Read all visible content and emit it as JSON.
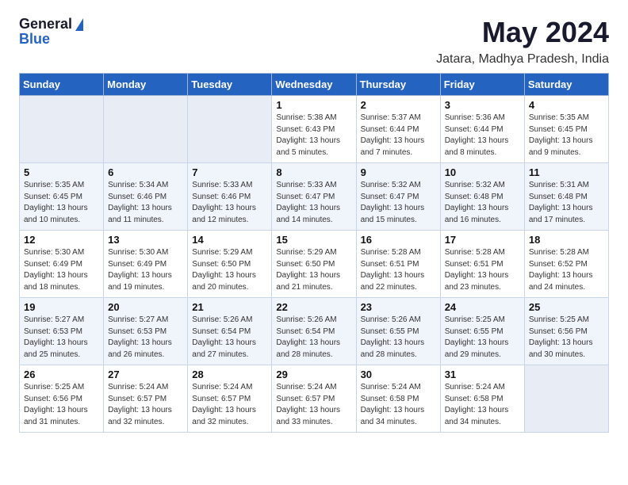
{
  "logo": {
    "general": "General",
    "blue": "Blue"
  },
  "title": "May 2024",
  "location": "Jatara, Madhya Pradesh, India",
  "days_of_week": [
    "Sunday",
    "Monday",
    "Tuesday",
    "Wednesday",
    "Thursday",
    "Friday",
    "Saturday"
  ],
  "weeks": [
    {
      "cells": [
        {
          "day": "",
          "info": ""
        },
        {
          "day": "",
          "info": ""
        },
        {
          "day": "",
          "info": ""
        },
        {
          "day": "1",
          "info": "Sunrise: 5:38 AM\nSunset: 6:43 PM\nDaylight: 13 hours\nand 5 minutes."
        },
        {
          "day": "2",
          "info": "Sunrise: 5:37 AM\nSunset: 6:44 PM\nDaylight: 13 hours\nand 7 minutes."
        },
        {
          "day": "3",
          "info": "Sunrise: 5:36 AM\nSunset: 6:44 PM\nDaylight: 13 hours\nand 8 minutes."
        },
        {
          "day": "4",
          "info": "Sunrise: 5:35 AM\nSunset: 6:45 PM\nDaylight: 13 hours\nand 9 minutes."
        }
      ]
    },
    {
      "cells": [
        {
          "day": "5",
          "info": "Sunrise: 5:35 AM\nSunset: 6:45 PM\nDaylight: 13 hours\nand 10 minutes."
        },
        {
          "day": "6",
          "info": "Sunrise: 5:34 AM\nSunset: 6:46 PM\nDaylight: 13 hours\nand 11 minutes."
        },
        {
          "day": "7",
          "info": "Sunrise: 5:33 AM\nSunset: 6:46 PM\nDaylight: 13 hours\nand 12 minutes."
        },
        {
          "day": "8",
          "info": "Sunrise: 5:33 AM\nSunset: 6:47 PM\nDaylight: 13 hours\nand 14 minutes."
        },
        {
          "day": "9",
          "info": "Sunrise: 5:32 AM\nSunset: 6:47 PM\nDaylight: 13 hours\nand 15 minutes."
        },
        {
          "day": "10",
          "info": "Sunrise: 5:32 AM\nSunset: 6:48 PM\nDaylight: 13 hours\nand 16 minutes."
        },
        {
          "day": "11",
          "info": "Sunrise: 5:31 AM\nSunset: 6:48 PM\nDaylight: 13 hours\nand 17 minutes."
        }
      ]
    },
    {
      "cells": [
        {
          "day": "12",
          "info": "Sunrise: 5:30 AM\nSunset: 6:49 PM\nDaylight: 13 hours\nand 18 minutes."
        },
        {
          "day": "13",
          "info": "Sunrise: 5:30 AM\nSunset: 6:49 PM\nDaylight: 13 hours\nand 19 minutes."
        },
        {
          "day": "14",
          "info": "Sunrise: 5:29 AM\nSunset: 6:50 PM\nDaylight: 13 hours\nand 20 minutes."
        },
        {
          "day": "15",
          "info": "Sunrise: 5:29 AM\nSunset: 6:50 PM\nDaylight: 13 hours\nand 21 minutes."
        },
        {
          "day": "16",
          "info": "Sunrise: 5:28 AM\nSunset: 6:51 PM\nDaylight: 13 hours\nand 22 minutes."
        },
        {
          "day": "17",
          "info": "Sunrise: 5:28 AM\nSunset: 6:51 PM\nDaylight: 13 hours\nand 23 minutes."
        },
        {
          "day": "18",
          "info": "Sunrise: 5:28 AM\nSunset: 6:52 PM\nDaylight: 13 hours\nand 24 minutes."
        }
      ]
    },
    {
      "cells": [
        {
          "day": "19",
          "info": "Sunrise: 5:27 AM\nSunset: 6:53 PM\nDaylight: 13 hours\nand 25 minutes."
        },
        {
          "day": "20",
          "info": "Sunrise: 5:27 AM\nSunset: 6:53 PM\nDaylight: 13 hours\nand 26 minutes."
        },
        {
          "day": "21",
          "info": "Sunrise: 5:26 AM\nSunset: 6:54 PM\nDaylight: 13 hours\nand 27 minutes."
        },
        {
          "day": "22",
          "info": "Sunrise: 5:26 AM\nSunset: 6:54 PM\nDaylight: 13 hours\nand 28 minutes."
        },
        {
          "day": "23",
          "info": "Sunrise: 5:26 AM\nSunset: 6:55 PM\nDaylight: 13 hours\nand 28 minutes."
        },
        {
          "day": "24",
          "info": "Sunrise: 5:25 AM\nSunset: 6:55 PM\nDaylight: 13 hours\nand 29 minutes."
        },
        {
          "day": "25",
          "info": "Sunrise: 5:25 AM\nSunset: 6:56 PM\nDaylight: 13 hours\nand 30 minutes."
        }
      ]
    },
    {
      "cells": [
        {
          "day": "26",
          "info": "Sunrise: 5:25 AM\nSunset: 6:56 PM\nDaylight: 13 hours\nand 31 minutes."
        },
        {
          "day": "27",
          "info": "Sunrise: 5:24 AM\nSunset: 6:57 PM\nDaylight: 13 hours\nand 32 minutes."
        },
        {
          "day": "28",
          "info": "Sunrise: 5:24 AM\nSunset: 6:57 PM\nDaylight: 13 hours\nand 32 minutes."
        },
        {
          "day": "29",
          "info": "Sunrise: 5:24 AM\nSunset: 6:57 PM\nDaylight: 13 hours\nand 33 minutes."
        },
        {
          "day": "30",
          "info": "Sunrise: 5:24 AM\nSunset: 6:58 PM\nDaylight: 13 hours\nand 34 minutes."
        },
        {
          "day": "31",
          "info": "Sunrise: 5:24 AM\nSunset: 6:58 PM\nDaylight: 13 hours\nand 34 minutes."
        },
        {
          "day": "",
          "info": ""
        }
      ]
    }
  ]
}
